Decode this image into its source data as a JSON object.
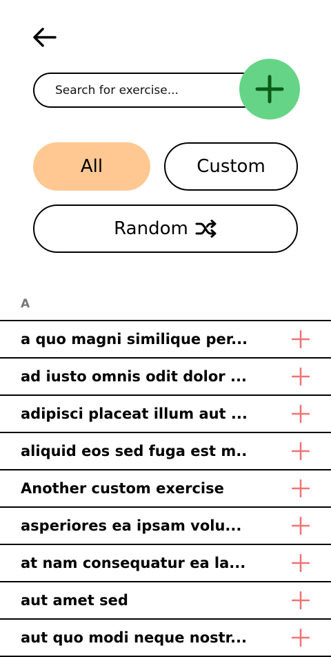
{
  "header": {
    "back_icon": "arrow-left-icon"
  },
  "search": {
    "placeholder": "Search for exercise...",
    "value": ""
  },
  "fab": {
    "icon": "plus-icon",
    "color": "#66d486",
    "icon_color": "#0a5c17"
  },
  "filters": {
    "all_label": "All",
    "custom_label": "Custom",
    "random_label": "Random",
    "random_icon": "shuffle-icon",
    "active_color": "#ffc892",
    "active": "All"
  },
  "section": {
    "letter": "A"
  },
  "exercises": [
    {
      "name": "a quo magni similique per..."
    },
    {
      "name": "ad iusto omnis odit dolor ..."
    },
    {
      "name": "adipisci placeat illum aut ..."
    },
    {
      "name": "aliquid eos sed fuga est m..."
    },
    {
      "name": "Another custom exercise"
    },
    {
      "name": "asperiores ea ipsam volu..."
    },
    {
      "name": "at nam consequatur ea la..."
    },
    {
      "name": "aut amet sed"
    },
    {
      "name": "aut quo modi neque nostr..."
    }
  ],
  "row_add_icon": "plus-icon",
  "row_add_color": "#f07474"
}
